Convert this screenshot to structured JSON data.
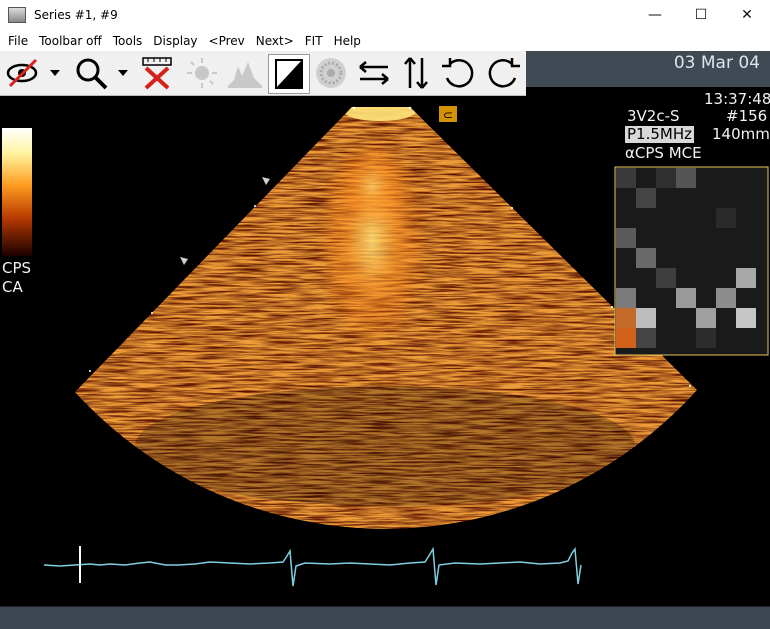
{
  "window": {
    "title": "Series #1, #9",
    "minimize": "—",
    "maximize": "☐",
    "close": "✕"
  },
  "menu": [
    {
      "label": "File"
    },
    {
      "label": "Toolbar off"
    },
    {
      "label": "Tools"
    },
    {
      "label": "Display"
    },
    {
      "label": "<Prev"
    },
    {
      "label": "Next>"
    },
    {
      "label": "FIT"
    },
    {
      "label": "Help"
    }
  ],
  "toolbar": {
    "icons": [
      "eye-hide-icon",
      "zoom-icon",
      "ruler-delete-icon",
      "brightness-icon",
      "histogram-icon",
      "contrast-icon",
      "filter-icon",
      "flip-horizontal-icon",
      "flip-vertical-icon",
      "rotate-left-icon",
      "rotate-right-icon"
    ]
  },
  "overlay": {
    "date": "03 Mar 04",
    "time": "13:37:48",
    "probe": "3V2c-S",
    "frame": "#156",
    "freq": "P1.5MHz",
    "depth": "140mm",
    "mode": "αCPS MCE",
    "colorbar_label_1": "CPS",
    "colorbar_label_2": "CA",
    "focus_marker": "⊂"
  },
  "colors": {
    "viewer_bg": "#000000",
    "ecg": "#7ecfe0",
    "status": "#3d4753"
  }
}
